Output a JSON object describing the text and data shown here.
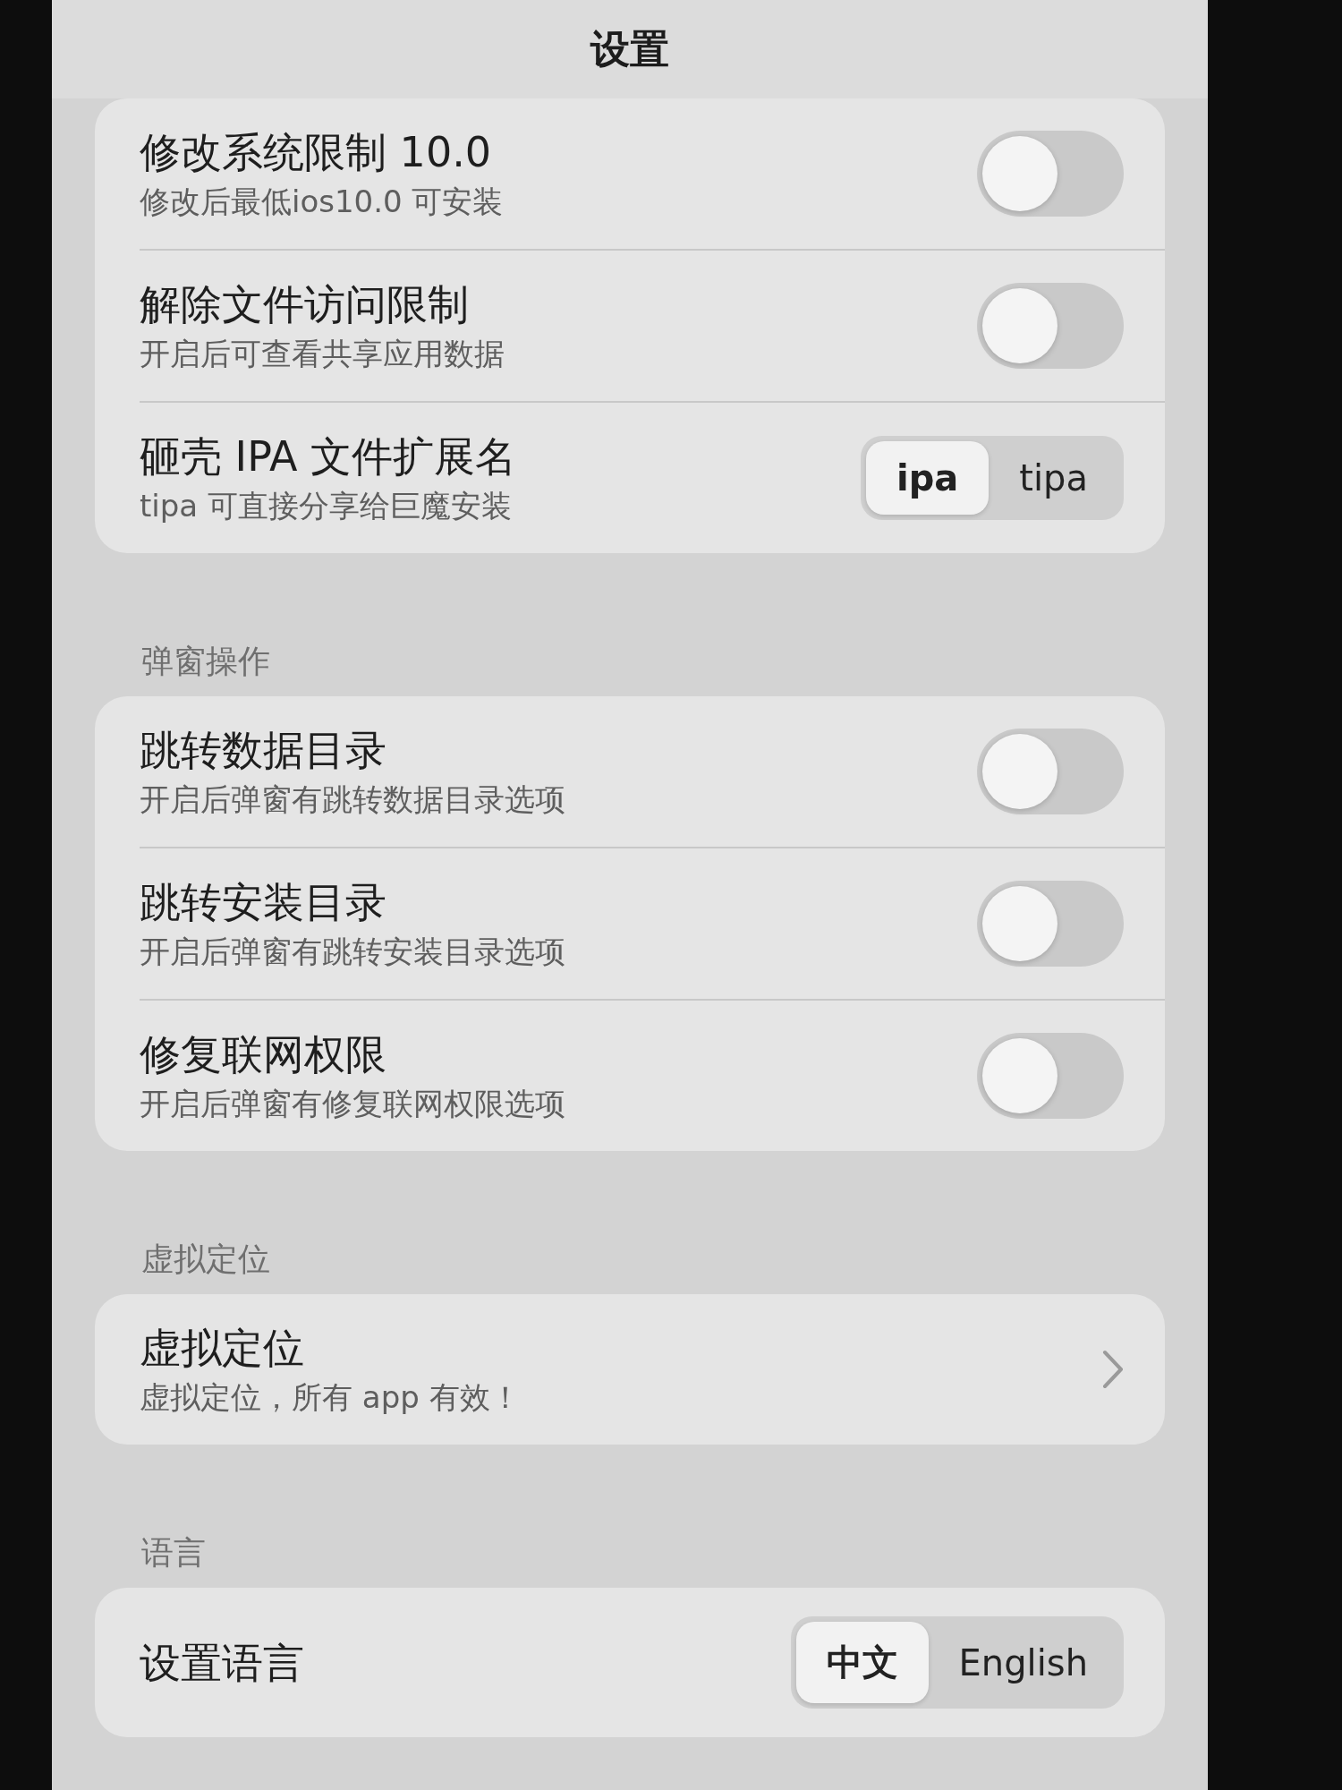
{
  "nav_bar": {
    "title": "设置"
  },
  "sections": [
    {
      "rows": [
        {
          "kind": "toggle",
          "title": "修改系统限制 10.0",
          "subtitle": "修改后最低ios10.0 可安装",
          "on": false
        },
        {
          "kind": "toggle",
          "title": "解除文件访问限制",
          "subtitle": "开启后可查看共享应用数据",
          "on": false
        },
        {
          "kind": "segmented",
          "title": "砸壳 IPA 文件扩展名",
          "subtitle": "tipa 可直接分享给巨魔安装",
          "options": [
            {
              "label": "ipa",
              "selected": true
            },
            {
              "label": "tipa",
              "selected": false
            }
          ]
        }
      ]
    },
    {
      "header": "弹窗操作",
      "rows": [
        {
          "kind": "toggle",
          "title": "跳转数据目录",
          "subtitle": "开启后弹窗有跳转数据目录选项",
          "on": false
        },
        {
          "kind": "toggle",
          "title": "跳转安装目录",
          "subtitle": "开启后弹窗有跳转安装目录选项",
          "on": false
        },
        {
          "kind": "toggle",
          "title": "修复联网权限",
          "subtitle": "开启后弹窗有修复联网权限选项",
          "on": false
        }
      ]
    },
    {
      "header": "虚拟定位",
      "rows": [
        {
          "kind": "link",
          "title": "虚拟定位",
          "subtitle": "虚拟定位，所有 app 有效！"
        }
      ]
    },
    {
      "header": "语言",
      "rows": [
        {
          "kind": "segmented",
          "title": "设置语言",
          "options": [
            {
              "label": "中文",
              "selected": true
            },
            {
              "label": "English",
              "selected": false
            }
          ]
        }
      ]
    }
  ]
}
